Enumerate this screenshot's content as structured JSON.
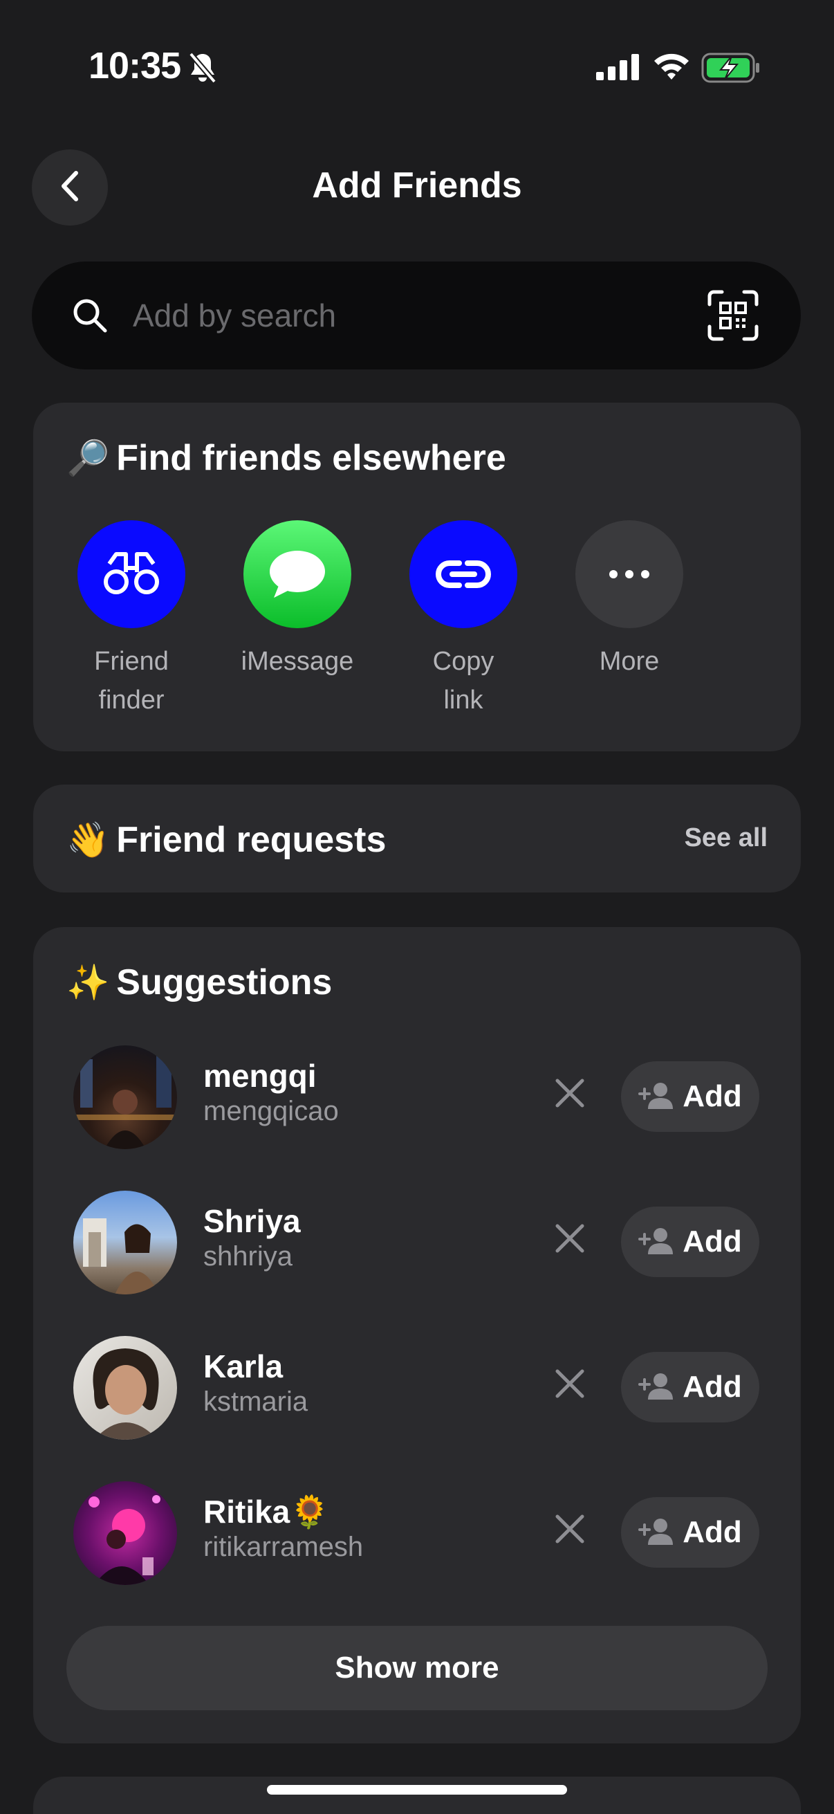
{
  "status": {
    "time": "10:35",
    "icons": [
      "bell-slash-icon",
      "signal-icon",
      "wifi-icon",
      "battery-charging-icon"
    ]
  },
  "header": {
    "title": "Add Friends",
    "back_icon": "chevron-left-icon"
  },
  "search": {
    "placeholder": "Add by search",
    "value": "",
    "icon": "search-icon",
    "scan_icon": "qr-scan-icon"
  },
  "find_friends": {
    "emoji": "🔎",
    "title": "Find friends elsewhere",
    "options": [
      {
        "label": "Friend finder",
        "icon": "binoculars-icon",
        "color": "#0a0aff"
      },
      {
        "label": "iMessage",
        "icon": "imessage-icon",
        "color": "#34c759"
      },
      {
        "label": "Copy link",
        "icon": "link-icon",
        "color": "#0a0aff"
      },
      {
        "label": "More",
        "icon": "more-icon",
        "color": "#3a3a3d"
      }
    ]
  },
  "friend_requests": {
    "emoji": "👋",
    "title": "Friend requests",
    "see_all": "See all"
  },
  "suggestions": {
    "emoji": "✨",
    "title": "Suggestions",
    "add_label": "Add",
    "items": [
      {
        "name": "mengqi",
        "handle": "mengqicao"
      },
      {
        "name": "Shriya",
        "handle": "shhriya"
      },
      {
        "name": "Karla",
        "handle": "kstmaria"
      },
      {
        "name": "Ritika🌻",
        "handle": "ritikarramesh"
      }
    ],
    "show_more": "Show more"
  },
  "colors": {
    "background": "#1c1c1e",
    "card": "#2a2a2d",
    "button": "#3a3a3d",
    "accent_blue": "#0a0aff",
    "imessage_green": "#34c759"
  }
}
